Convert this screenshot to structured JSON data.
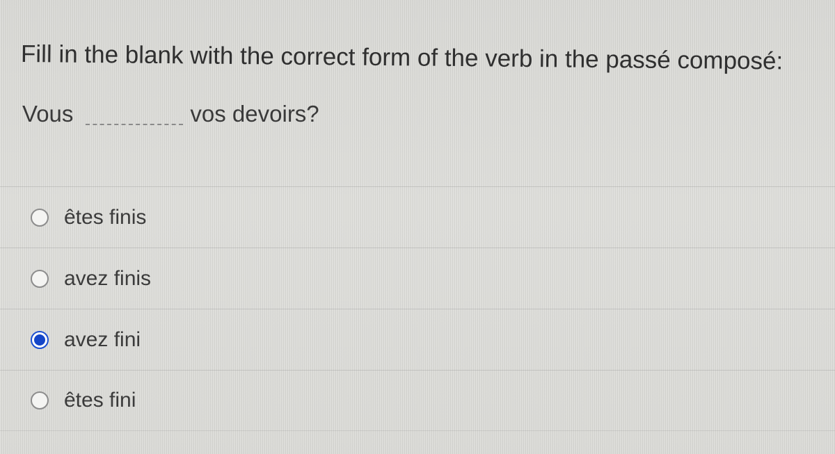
{
  "question": {
    "prompt": "Fill in the blank with the correct form of the verb in the passé composé:",
    "sentence_start": "Vous",
    "sentence_end": "vos devoirs?"
  },
  "options": [
    {
      "label": "êtes finis",
      "selected": false
    },
    {
      "label": "avez finis",
      "selected": false
    },
    {
      "label": "avez fini",
      "selected": true
    },
    {
      "label": "êtes fini",
      "selected": false
    }
  ],
  "colors": {
    "selected_radio": "#1546c8",
    "text": "#3a3a3a",
    "background": "#dadad6"
  }
}
